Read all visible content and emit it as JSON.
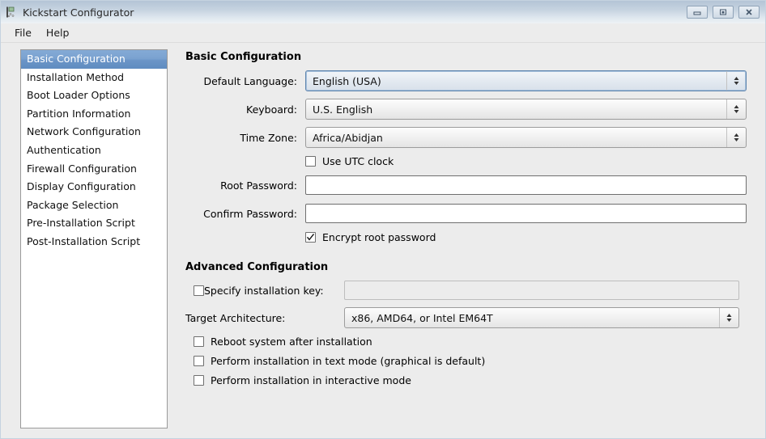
{
  "window": {
    "title": "Kickstart Configurator",
    "icon": "app-icon",
    "controls": {
      "minimize_label": "Minimize",
      "maximize_label": "Maximize",
      "close_label": "Close"
    }
  },
  "menubar": {
    "items": [
      {
        "label": "File"
      },
      {
        "label": "Help"
      }
    ]
  },
  "sidebar": {
    "items": [
      {
        "label": "Basic Configuration",
        "selected": true
      },
      {
        "label": "Installation Method",
        "selected": false
      },
      {
        "label": "Boot Loader Options",
        "selected": false
      },
      {
        "label": "Partition Information",
        "selected": false
      },
      {
        "label": "Network Configuration",
        "selected": false
      },
      {
        "label": "Authentication",
        "selected": false
      },
      {
        "label": "Firewall Configuration",
        "selected": false
      },
      {
        "label": "Display Configuration",
        "selected": false
      },
      {
        "label": "Package Selection",
        "selected": false
      },
      {
        "label": "Pre-Installation Script",
        "selected": false
      },
      {
        "label": "Post-Installation Script",
        "selected": false
      }
    ]
  },
  "basic": {
    "title": "Basic Configuration",
    "default_language": {
      "label": "Default Language:",
      "value": "English (USA)"
    },
    "keyboard": {
      "label": "Keyboard:",
      "value": "U.S. English"
    },
    "time_zone": {
      "label": "Time Zone:",
      "value": "Africa/Abidjan"
    },
    "use_utc_clock": {
      "label": "Use UTC clock",
      "checked": false
    },
    "root_password": {
      "label": "Root Password:",
      "value": "",
      "placeholder": ""
    },
    "confirm_password": {
      "label": "Confirm Password:",
      "value": "",
      "placeholder": ""
    },
    "encrypt_root_password": {
      "label": "Encrypt root password",
      "checked": true
    }
  },
  "advanced": {
    "title": "Advanced Configuration",
    "specify_installation_key": {
      "label": "Specify installation key:",
      "checked": false
    },
    "installation_key": {
      "value": "",
      "placeholder": "",
      "disabled": true
    },
    "target_architecture": {
      "label": "Target Architecture:",
      "value": "x86, AMD64, or Intel EM64T"
    },
    "reboot_after_install": {
      "label": "Reboot system after installation",
      "checked": false
    },
    "text_mode": {
      "label": "Perform installation in text mode (graphical is default)",
      "checked": false
    },
    "interactive_mode": {
      "label": "Perform installation in interactive mode",
      "checked": false
    }
  },
  "colors": {
    "titlebar_top": "#b4c4d6",
    "titlebar_bottom": "#eef2f5",
    "selection_blue": "#6b95c7",
    "window_bg": "#ececec",
    "list_bg": "#ffffff",
    "focus_border": "#5d84ae"
  }
}
